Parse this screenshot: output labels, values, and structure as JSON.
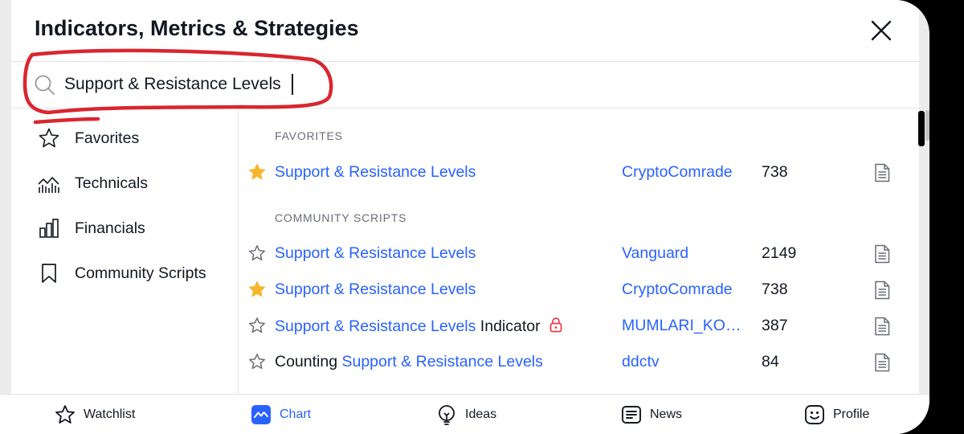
{
  "dialog": {
    "title": "Indicators, Metrics & Strategies",
    "close_icon": "close-icon"
  },
  "search": {
    "value": "Support & Resistance Levels",
    "placeholder": "Search"
  },
  "sidebar": {
    "items": [
      {
        "label": "Favorites",
        "icon": "star-outline-icon"
      },
      {
        "label": "Technicals",
        "icon": "technicals-icon"
      },
      {
        "label": "Financials",
        "icon": "bar-chart-icon"
      },
      {
        "label": "Community Scripts",
        "icon": "bookmark-icon"
      }
    ]
  },
  "sections": {
    "favorites": "FAVORITES",
    "community": "COMMUNITY SCRIPTS"
  },
  "favorites_rows": [
    {
      "prefix": "",
      "highlight": "Support & Resistance Levels",
      "suffix": "",
      "author": "CryptoComrade",
      "count": "738",
      "starred": true,
      "locked": false
    }
  ],
  "community_rows": [
    {
      "prefix": "",
      "highlight": "Support & Resistance Levels",
      "suffix": "",
      "author": "Vanguard",
      "count": "2149",
      "starred": false,
      "locked": false
    },
    {
      "prefix": "",
      "highlight": "Support & Resistance Levels",
      "suffix": "",
      "author": "CryptoComrade",
      "count": "738",
      "starred": true,
      "locked": false
    },
    {
      "prefix": "",
      "highlight": "Support & Resistance Levels",
      "suffix": " Indicator",
      "author": "MUMLARI_KO…",
      "count": "387",
      "starred": false,
      "locked": true
    },
    {
      "prefix": "Counting ",
      "highlight": "Support & Resistance Levels",
      "suffix": "",
      "author": "ddctv",
      "count": "84",
      "starred": false,
      "locked": false
    }
  ],
  "bottom_nav": [
    {
      "label": "Watchlist",
      "icon": "star-outline-icon",
      "active": false
    },
    {
      "label": "Chart",
      "icon": "chart-icon",
      "active": true
    },
    {
      "label": "Ideas",
      "icon": "lightbulb-icon",
      "active": false
    },
    {
      "label": "News",
      "icon": "news-icon",
      "active": false
    },
    {
      "label": "Profile",
      "icon": "smiley-icon",
      "active": false
    }
  ],
  "colors": {
    "accent": "#2962ff",
    "star_filled": "#f7b52c",
    "lock": "#f23645",
    "annotation": "#d9262f"
  }
}
